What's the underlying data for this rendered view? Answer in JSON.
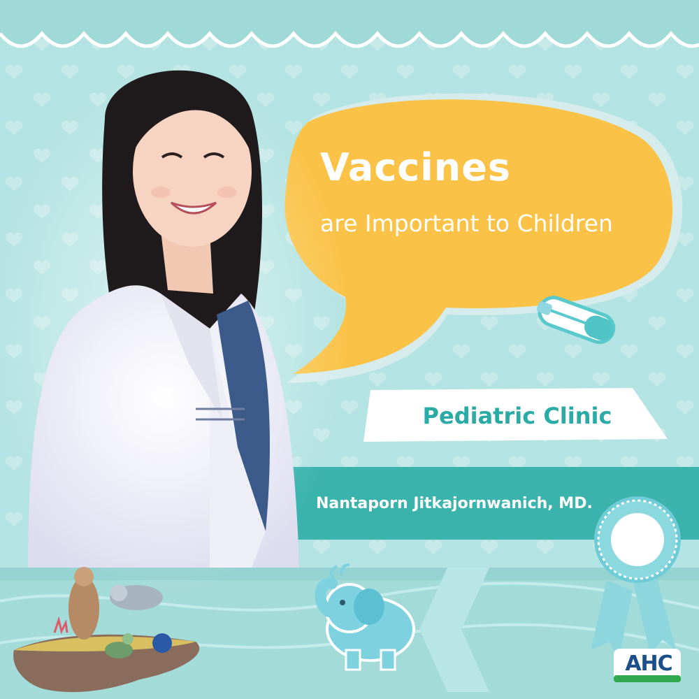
{
  "headline": "Vaccines",
  "subheadline": "are Important to Children",
  "clinic": "Pediatric Clinic",
  "doctor": "Nantaporn Jitkajornwanich, MD.",
  "logo_text": "AHC",
  "colors": {
    "background": "#b3e3e2",
    "speech_bubble": "#fac347",
    "banner_teal": "#3bb3ad",
    "clinic_text": "#2aaba5",
    "logo_blue": "#1a4e8c",
    "logo_green": "#2fa84f"
  },
  "icons": [
    "heart-pattern",
    "safety-pin-icon",
    "rosette-badge-icon",
    "elephant-icon",
    "sea-creatures-illustration",
    "ahc-logo"
  ]
}
